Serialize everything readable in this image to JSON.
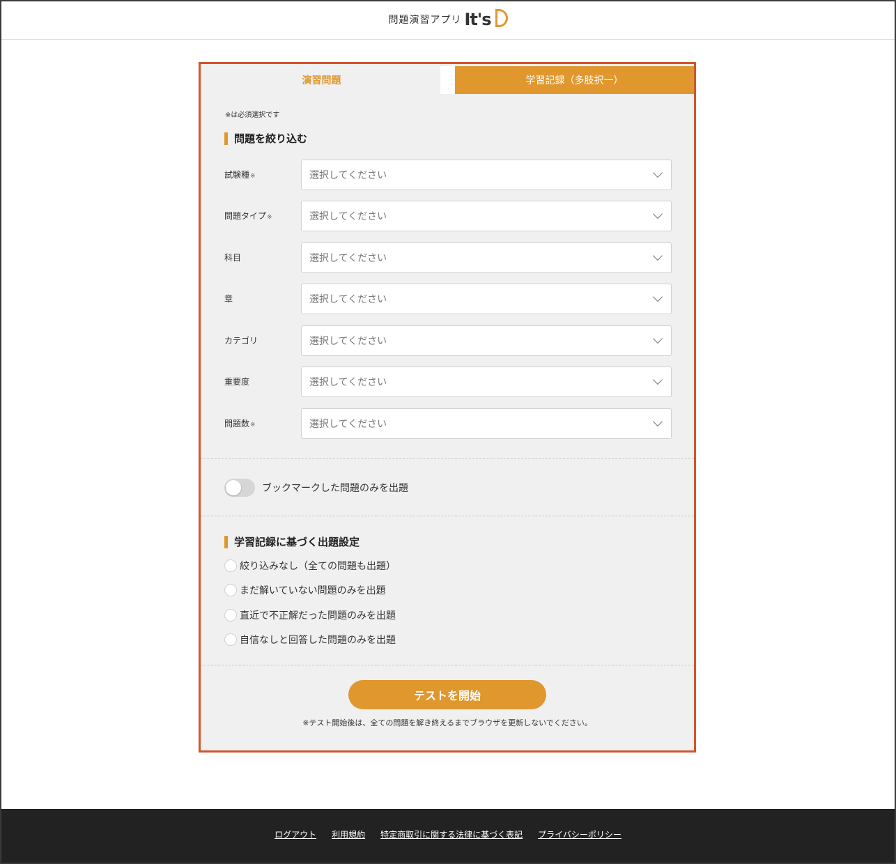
{
  "header": {
    "logo_text": "問題演習アプリ",
    "logo_mark": "It's"
  },
  "tabs": [
    {
      "label": "演習問題",
      "active": true
    },
    {
      "label": "学習記録（多肢択一）",
      "active": false
    }
  ],
  "form": {
    "required_note": "※は必須選択です",
    "filter_title": "問題を絞り込む",
    "required_mark": "※",
    "fields": [
      {
        "label": "試験種",
        "required": true,
        "value": "選択してください"
      },
      {
        "label": "問題タイプ",
        "required": true,
        "value": "選択してください"
      },
      {
        "label": "科目",
        "required": false,
        "value": "選択してください"
      },
      {
        "label": "章",
        "required": false,
        "value": "選択してください"
      },
      {
        "label": "カテゴリ",
        "required": false,
        "value": "選択してください"
      },
      {
        "label": "重要度",
        "required": false,
        "value": "選択してください"
      },
      {
        "label": "問題数",
        "required": true,
        "value": "選択してください"
      }
    ],
    "bookmark_toggle": {
      "label": "ブックマークした問題のみを出題",
      "on": false
    },
    "history_title": "学習記録に基づく出題設定",
    "history_options": [
      {
        "label": "絞り込みなし（全ての問題も出題）",
        "checked": false
      },
      {
        "label": "まだ解いていない問題のみを出題",
        "checked": false
      },
      {
        "label": "直近で不正解だった問題のみを出題",
        "checked": false
      },
      {
        "label": "自信なしと回答した問題のみを出題",
        "checked": false
      }
    ],
    "start_button": "テストを開始",
    "start_note": "※テスト開始後は、全ての問題を解き終えるまでブラウザを更新しないでください。"
  },
  "footer": {
    "links": [
      "ログアウト",
      "利用規約",
      "特定商取引に関する法律に基づく表記",
      "プライバシーポリシー"
    ]
  },
  "colors": {
    "accent": "#e0982e",
    "panel_border": "#d0552b",
    "panel_bg": "#f0f0f0",
    "footer_bg": "#222222"
  }
}
